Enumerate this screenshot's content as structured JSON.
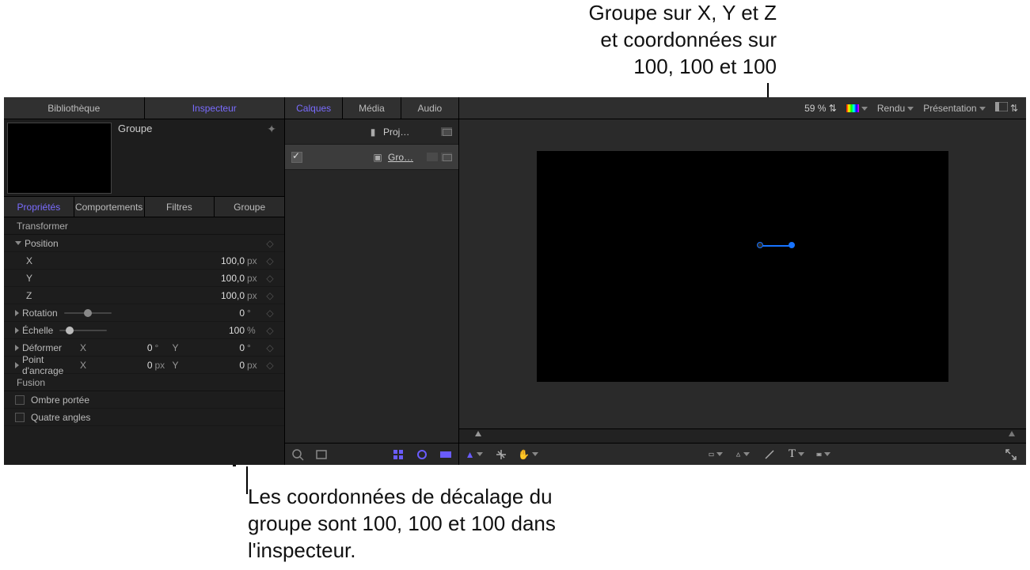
{
  "annotations": {
    "top": "Groupe sur X, Y et Z\net coordonnées sur\n100, 100 et 100",
    "bottom": "Les coordonnées de décalage du\ngroupe sont 100, 100 et 100 dans\nl'inspecteur."
  },
  "left_tabs": {
    "library": "Bibliothèque",
    "inspector": "Inspecteur"
  },
  "inspector": {
    "object_name": "Groupe",
    "sub_tabs": {
      "properties": "Propriétés",
      "behaviors": "Comportements",
      "filters": "Filtres",
      "group": "Groupe"
    },
    "sections": {
      "transform": "Transformer",
      "position": "Position",
      "rotation": "Rotation",
      "scale": "Échelle",
      "shear": "Déformer",
      "anchor": "Point d'ancrage",
      "blend": "Fusion",
      "drop_shadow": "Ombre portée",
      "four_corner": "Quatre angles"
    },
    "position": {
      "x": {
        "label": "X",
        "value": "100,0",
        "unit": "px"
      },
      "y": {
        "label": "Y",
        "value": "100,0",
        "unit": "px"
      },
      "z": {
        "label": "Z",
        "value": "100,0",
        "unit": "px"
      }
    },
    "rotation": {
      "value": "0",
      "unit": "°"
    },
    "scale": {
      "value": "100",
      "unit": "%"
    },
    "shear": {
      "x": {
        "value": "0",
        "unit": "°"
      },
      "y": {
        "value": "0",
        "unit": "°"
      }
    },
    "anchor": {
      "x": {
        "value": "0",
        "unit": "px"
      },
      "y": {
        "value": "0",
        "unit": "px"
      }
    }
  },
  "mid_tabs": {
    "layers": "Calques",
    "media": "Média",
    "audio": "Audio"
  },
  "layers": {
    "project": "Proj…",
    "group": "Gro…"
  },
  "canvas_bar": {
    "zoom": "59 %",
    "render": "Rendu",
    "view": "Présentation"
  }
}
